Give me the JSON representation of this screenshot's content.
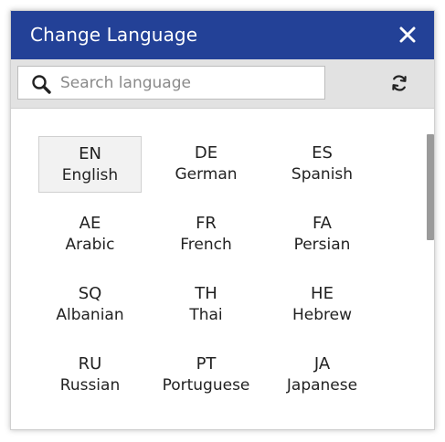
{
  "header": {
    "title": "Change Language"
  },
  "toolbar": {
    "search_placeholder": "Search language"
  },
  "languages": [
    {
      "code": "EN",
      "name": "English",
      "selected": true
    },
    {
      "code": "DE",
      "name": "German",
      "selected": false
    },
    {
      "code": "ES",
      "name": "Spanish",
      "selected": false
    },
    {
      "code": "AE",
      "name": "Arabic",
      "selected": false
    },
    {
      "code": "FR",
      "name": "French",
      "selected": false
    },
    {
      "code": "FA",
      "name": "Persian",
      "selected": false
    },
    {
      "code": "SQ",
      "name": "Albanian",
      "selected": false
    },
    {
      "code": "TH",
      "name": "Thai",
      "selected": false
    },
    {
      "code": "HE",
      "name": "Hebrew",
      "selected": false
    },
    {
      "code": "RU",
      "name": "Russian",
      "selected": false
    },
    {
      "code": "PT",
      "name": "Portuguese",
      "selected": false
    },
    {
      "code": "JA",
      "name": "Japanese",
      "selected": false
    }
  ],
  "icons": {
    "close": "close-icon",
    "search": "search-icon",
    "refresh": "refresh-icon"
  },
  "colors": {
    "header_bg": "#234197",
    "header_text": "#ffffff",
    "toolbar_bg": "#e2e2e2",
    "selected_bg": "#f2f2f2"
  }
}
